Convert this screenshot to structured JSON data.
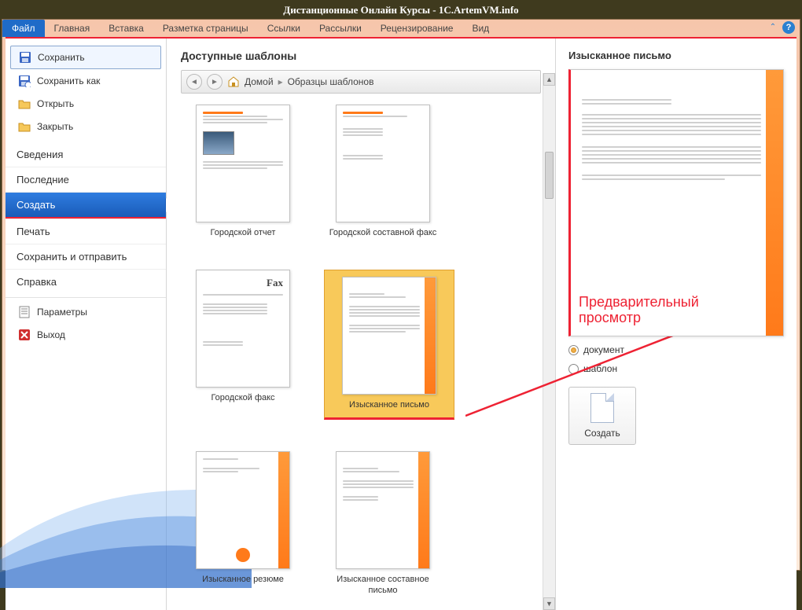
{
  "title": "Дистанционные Онлайн Курсы - 1C.ArtemVM.info",
  "ribbon": {
    "tabs": [
      "Файл",
      "Главная",
      "Вставка",
      "Разметка страницы",
      "Ссылки",
      "Рассылки",
      "Рецензирование",
      "Вид"
    ]
  },
  "sidebar": {
    "save": "Сохранить",
    "save_as": "Сохранить как",
    "open": "Открыть",
    "close": "Закрыть",
    "info": "Сведения",
    "recent": "Последние",
    "create": "Создать",
    "print": "Печать",
    "save_send": "Сохранить и отправить",
    "help": "Справка",
    "options": "Параметры",
    "exit": "Выход"
  },
  "center": {
    "heading": "Доступные шаблоны",
    "breadcrumb_home": "Домой",
    "breadcrumb_samples": "Образцы шаблонов",
    "templates": {
      "tpl0": "Городской отчет",
      "tpl1": "Городской составной факс",
      "tpl2": "Городской факс",
      "tpl3": "Изысканное письмо",
      "tpl4": "Изысканное резюме",
      "tpl5": "Изысканное составное письмо"
    },
    "fax_label": "Fax"
  },
  "preview": {
    "heading": "Изысканное письмо",
    "annotation_l1": "Предварительный",
    "annotation_l2": "просмотр",
    "radio_doc": "документ",
    "radio_tpl": "шаблон",
    "create_btn": "Создать"
  }
}
